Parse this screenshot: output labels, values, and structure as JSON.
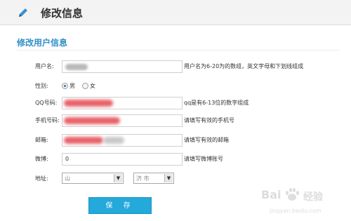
{
  "header": {
    "title": "修改信息",
    "icon": "pencil-icon"
  },
  "section": {
    "title": "修改用户信息"
  },
  "form": {
    "username": {
      "label": "用户名:",
      "hint": "用户名为6-20为的数组，英文字母和下划线组成"
    },
    "gender": {
      "label": "性别:",
      "options": [
        "男",
        "女"
      ],
      "selected": "男"
    },
    "qq": {
      "label": "QQ号码:",
      "hint": "qq是有6-13位的数字组成"
    },
    "phone": {
      "label": "手机号码:",
      "hint": "请填写有效的手机号"
    },
    "email": {
      "label": "邮箱:",
      "hint": "请填写有效的邮箱"
    },
    "weibo": {
      "label": "微博:",
      "value": "0",
      "hint": "请填写微博账号"
    },
    "address": {
      "label": "地址:",
      "province": "山",
      "city": "济   市"
    }
  },
  "save_button": {
    "label": "保 存"
  },
  "watermark": {
    "brand": "Bai",
    "sub": "经验",
    "url": "jingyan.baidu.com"
  },
  "colors": {
    "accent": "#2f8fc8",
    "button": "#23a9da",
    "redact_red": "#e8626a"
  }
}
